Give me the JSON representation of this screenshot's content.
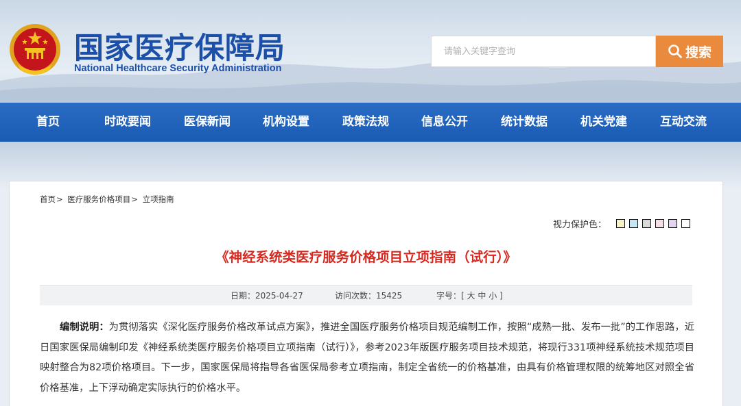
{
  "header": {
    "title": "国家医疗保障局",
    "subtitle": "National Healthcare Security Administration",
    "emblem_icon": "national-emblem-icon",
    "search": {
      "placeholder": "请输入关键字查询",
      "button_label": "搜索",
      "button_color": "#ea8a3c",
      "icon": "search-icon"
    }
  },
  "nav": {
    "background": "#1a5bb4",
    "items": [
      {
        "label": "首页"
      },
      {
        "label": "时政要闻"
      },
      {
        "label": "医保新闻"
      },
      {
        "label": "机构设置"
      },
      {
        "label": "政策法规"
      },
      {
        "label": "信息公开"
      },
      {
        "label": "统计数据"
      },
      {
        "label": "机关党建"
      },
      {
        "label": "互动交流"
      }
    ]
  },
  "breadcrumb": [
    {
      "label": "首页",
      "sep": ">"
    },
    {
      "label": "医疗服务价格项目",
      "sep": ">"
    },
    {
      "label": "立项指南",
      "sep": ""
    }
  ],
  "eye_protection": {
    "label": "视力保护色：",
    "colors": [
      "#f7f2c6",
      "#c6e6f5",
      "#d9d9d9",
      "#f4dfe6",
      "#e3d3ef",
      "#ffffff"
    ]
  },
  "article": {
    "title": "《神经系统类医疗服务价格项目立项指南（试行）》",
    "title_color": "#d62a21",
    "meta": {
      "date_label": "日期：",
      "date": "2025-04-27",
      "views_label": "访问次数：",
      "views": "15425",
      "font_label": "字号：",
      "font_open": "[",
      "font_large": "大",
      "font_medium": "中",
      "font_small": "小",
      "font_close": "]"
    },
    "lead_label": "编制说明：",
    "lead_text": "为贯彻落实《深化医疗服务价格改革试点方案》，推进全国医疗服务价格项目规范编制工作，按照“成熟一批、发布一批”的工作思路，近日国家医保局编制印发《神经系统类医疗服务价格项目立项指南（试行）》，参考2023年版医疗服务项目技术规范，将现行331项神经系统技术规范项目映射整合为82项价格项目。下一步，国家医保局将指导各省医保局参考立项指南，制定全省统一的价格基准，由具有价格管理权限的统筹地区对照全省价格基准，上下浮动确定实际执行的价格水平。"
  }
}
